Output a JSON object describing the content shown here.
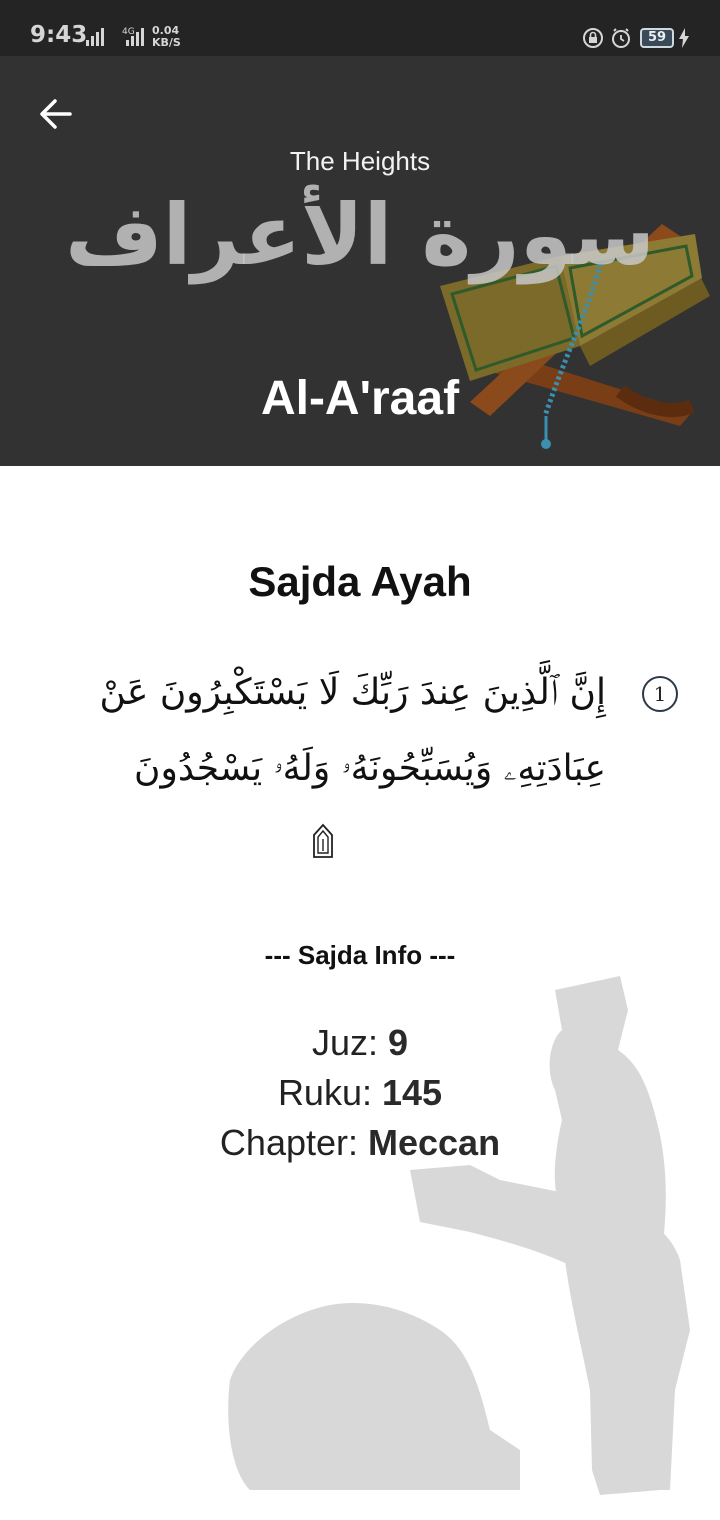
{
  "status_bar": {
    "time": "9:43",
    "network_type": "4G",
    "speed_value": "0.04",
    "speed_unit": "KB/S",
    "battery": "59"
  },
  "header": {
    "subtitle": "The Heights",
    "arabic_name": "سورة الأعراف",
    "english_name": "Al-A'raaf"
  },
  "content": {
    "section_title": "Sajda Ayah",
    "ayah_number": "1",
    "ayah_text": "إِنَّ ٱلَّذِينَ عِندَ رَبِّكَ لَا يَسْتَكْبِرُونَ عَنْ عِبَادَتِهِۦ وَيُسَبِّحُونَهُۥ وَلَهُۥ يَسْجُدُونَ",
    "info_heading": "--- Sajda Info ---",
    "juz_label": "Juz: ",
    "juz_value": "9",
    "ruku_label": "Ruku: ",
    "ruku_value": "145",
    "chapter_label": "Chapter: ",
    "chapter_value": "Meccan"
  },
  "colors": {
    "status_bar_bg": "#242424",
    "header_bg": "#323232",
    "page_bg": "#ffffff"
  },
  "icons": {
    "back": "arrow-left-icon",
    "sajda_mark": "sajda-mark-icon"
  }
}
